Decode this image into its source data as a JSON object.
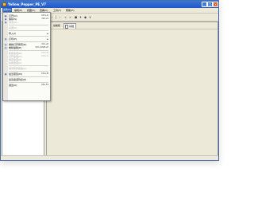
{
  "window": {
    "title": "Yellow_Pepper_PE_V7",
    "buttons": {
      "minimize": "_",
      "maximize": "□",
      "close": "×"
    }
  },
  "menubar": {
    "items": [
      {
        "label": "文件(F)",
        "active": true
      },
      {
        "label": "编辑(E)",
        "active": false
      },
      {
        "label": "视图(V)",
        "active": false
      },
      {
        "label": "查看(C)",
        "active": false
      },
      {
        "label": "工具(T)",
        "active": false
      },
      {
        "label": "帮助(H)",
        "active": false
      }
    ]
  },
  "toolbar": {
    "icons": [
      "new-icon",
      "open-icon",
      "save-icon",
      "refresh-icon",
      "view-icon",
      "list-icon",
      "search-icon",
      "zoom-icon",
      "prev-icon",
      "next-icon",
      "step-icon",
      "step2-icon",
      "back-icon",
      "forward-icon",
      "disk-icon",
      "plugin-icon",
      "settings-icon",
      "info-icon"
    ],
    "glyphs": [
      "▣",
      "◉",
      "◉",
      "▢",
      "▤",
      "▥",
      "⚲",
      "⚲",
      "‹",
      "›",
      "|",
      "‹",
      "«",
      "»",
      "◼",
      "✦",
      "◆",
      "ℹ"
    ]
  },
  "right_panel": {
    "tab_static": "总帐和",
    "tab_label": "基础"
  },
  "file_menu": {
    "items": [
      {
        "type": "item",
        "label": "打开(O)",
        "shortcut": "Ctrl+O",
        "icon": "▣",
        "disabled": false
      },
      {
        "type": "item",
        "label": "保存(S)",
        "shortcut": "Ctrl+S",
        "icon": "◉",
        "disabled": false
      },
      {
        "type": "item",
        "label": "另存(A)...",
        "shortcut": "",
        "icon": "◉",
        "disabled": true
      },
      {
        "type": "sep"
      },
      {
        "type": "item",
        "label": "关闭(C)",
        "shortcut": "",
        "icon": "",
        "disabled": true
      },
      {
        "type": "sep"
      },
      {
        "type": "item",
        "label": "导入(I)",
        "shortcut": "",
        "icon": "",
        "disabled": false,
        "submenu": true
      },
      {
        "type": "sep"
      },
      {
        "type": "item",
        "label": "打印(P)",
        "shortcut": "",
        "icon": "▤",
        "disabled": false,
        "submenu": true
      },
      {
        "type": "sep"
      },
      {
        "type": "item",
        "label": "重新打开所有(R)",
        "shortcut": "Ctrl+R",
        "icon": "▥",
        "disabled": false
      },
      {
        "type": "item",
        "label": "重新编辑(E)",
        "shortcut": "Ctrl+Shift+E",
        "icon": "▥",
        "disabled": false
      },
      {
        "type": "sep"
      },
      {
        "type": "item",
        "label": "新建会话(N)",
        "shortcut": "Ctrl+N",
        "icon": "",
        "disabled": true
      },
      {
        "type": "item",
        "label": "打开会话(O)",
        "shortcut": "Ctrl+O",
        "icon": "",
        "disabled": true
      },
      {
        "type": "item",
        "label": "保存会话(S)",
        "shortcut": "",
        "icon": "",
        "disabled": true
      },
      {
        "type": "item",
        "label": "关闭会话(C)",
        "shortcut": "",
        "icon": "",
        "disabled": true
      },
      {
        "type": "sep"
      },
      {
        "type": "item",
        "label": "保存所有修改(U)",
        "shortcut": "",
        "icon": "",
        "disabled": true
      },
      {
        "type": "sep"
      },
      {
        "type": "item",
        "label": "最近项目(M)",
        "shortcut": "Ctrl+M",
        "icon": "▦",
        "disabled": false
      },
      {
        "type": "sep"
      },
      {
        "type": "item",
        "label": "最近会话列表(E)",
        "shortcut": "",
        "icon": "",
        "disabled": false
      },
      {
        "type": "sep"
      },
      {
        "type": "item",
        "label": "退出(X)",
        "shortcut": "Alt+F4",
        "icon": "",
        "disabled": false
      }
    ]
  }
}
